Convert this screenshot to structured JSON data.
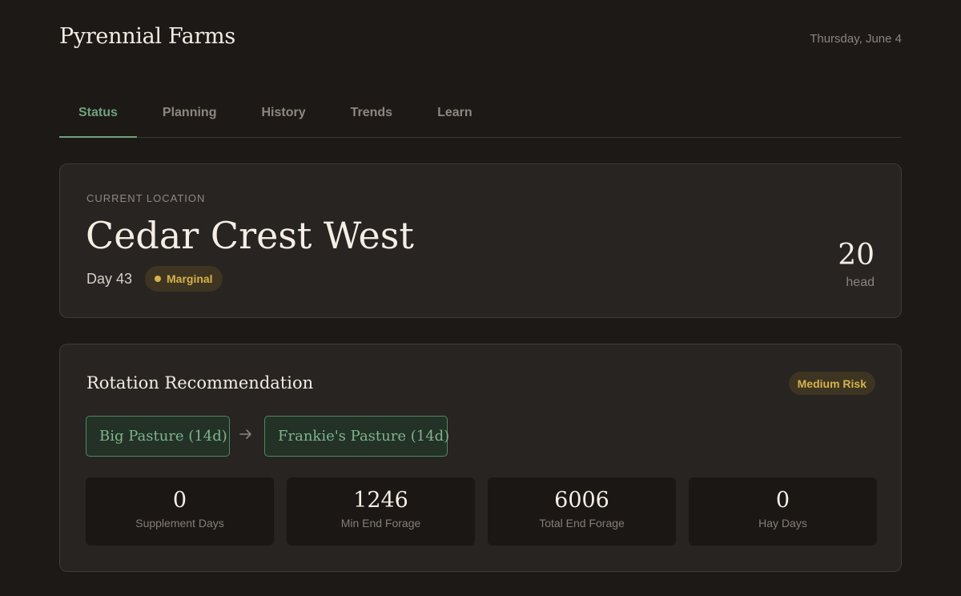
{
  "header": {
    "brand": "Pyrennial Farms",
    "date": "Thursday, June 4"
  },
  "tabs": [
    {
      "label": "Status",
      "active": true
    },
    {
      "label": "Planning",
      "active": false
    },
    {
      "label": "History",
      "active": false
    },
    {
      "label": "Trends",
      "active": false
    },
    {
      "label": "Learn",
      "active": false
    }
  ],
  "location": {
    "label": "CURRENT LOCATION",
    "name": "Cedar Crest West",
    "day": "Day 43",
    "status": "Marginal",
    "head_count": "20",
    "head_label": "head"
  },
  "rotation": {
    "title": "Rotation Recommendation",
    "risk": "Medium Risk",
    "from": "Big Pasture (14d)",
    "to": "Frankie's Pasture (14d)",
    "arrow_icon": "arrow-right-icon",
    "stats": [
      {
        "value": "0",
        "label": "Supplement Days"
      },
      {
        "value": "1246",
        "label": "Min End Forage"
      },
      {
        "value": "6006",
        "label": "Total End Forage"
      },
      {
        "value": "0",
        "label": "Hay Days"
      }
    ]
  },
  "colors": {
    "accent_green": "#6fa27c",
    "warning_yellow": "#d6b24c",
    "background": "#1c1917",
    "card": "#272422"
  }
}
